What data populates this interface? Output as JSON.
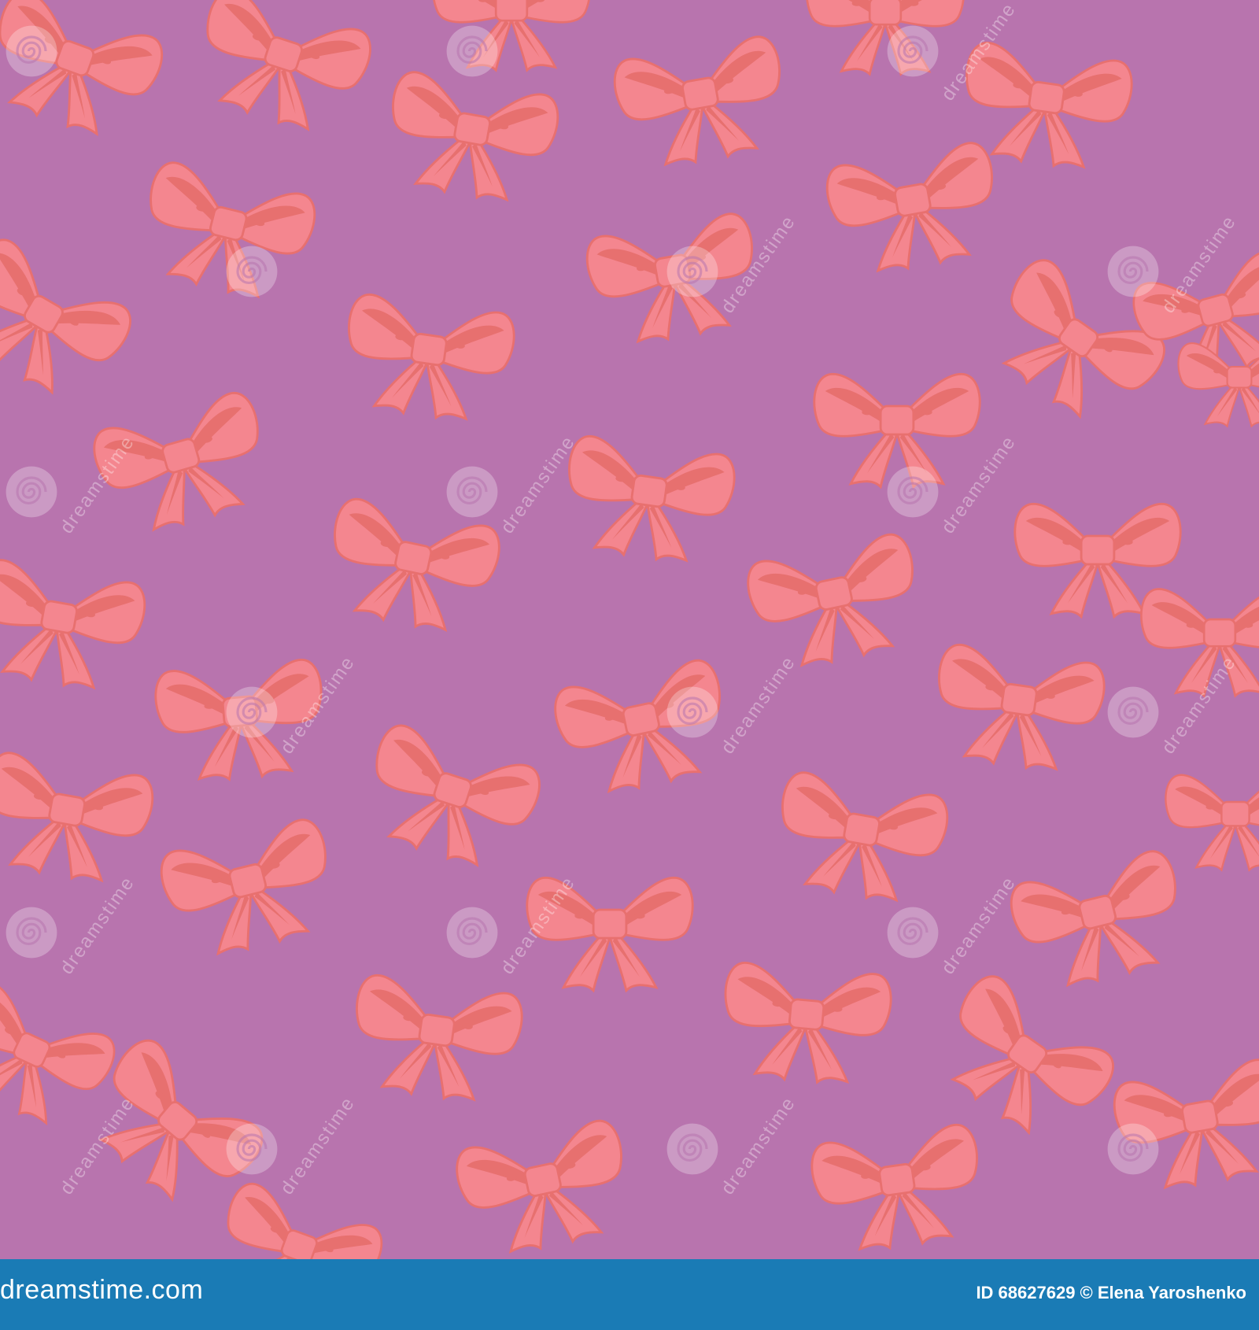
{
  "image": {
    "background_color": "#b874ae",
    "bow_fill": "#f4868f",
    "bow_shadow": "#e7706f",
    "bow_outline": "#e8706f"
  },
  "watermark": {
    "text": "dreamstime",
    "icon": "swirl-logo-icon"
  },
  "footer": {
    "site": "dreamstime.com",
    "credit": "ID 68627629 © Elena Yaroshenko",
    "color": "#1a7bb5"
  }
}
